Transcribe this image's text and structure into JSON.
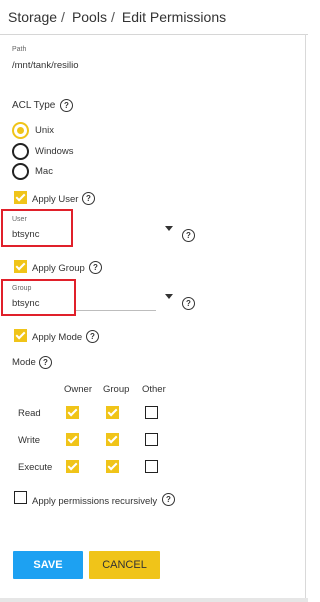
{
  "breadcrumb": {
    "items": [
      "Storage",
      "Pools",
      "Edit Permissions"
    ]
  },
  "path": {
    "label": "Path",
    "value": "/mnt/tank/resilio"
  },
  "acl_type": {
    "label": "ACL Type",
    "selected": "Unix",
    "options": [
      "Unix",
      "Windows",
      "Mac"
    ]
  },
  "apply_user": {
    "label": "Apply User",
    "checked": true
  },
  "user": {
    "label": "User",
    "value": "btsync"
  },
  "apply_group": {
    "label": "Apply Group",
    "checked": true
  },
  "group": {
    "label": "Group",
    "value": "btsync"
  },
  "apply_mode": {
    "label": "Apply Mode",
    "checked": true
  },
  "mode": {
    "label": "Mode",
    "columns": [
      "Owner",
      "Group",
      "Other"
    ],
    "rows": [
      {
        "label": "Read",
        "values": [
          true,
          true,
          false
        ]
      },
      {
        "label": "Write",
        "values": [
          true,
          true,
          false
        ]
      },
      {
        "label": "Execute",
        "values": [
          true,
          true,
          false
        ]
      }
    ]
  },
  "recursive": {
    "label": "Apply permissions recursively",
    "checked": false
  },
  "buttons": {
    "save": "SAVE",
    "cancel": "CANCEL"
  },
  "colors": {
    "accent": "#f0c419",
    "primary": "#1da1f2",
    "highlight": "#e0202a"
  },
  "icons": {
    "help": "help-circle-icon",
    "dropdown": "caret-down-icon"
  }
}
